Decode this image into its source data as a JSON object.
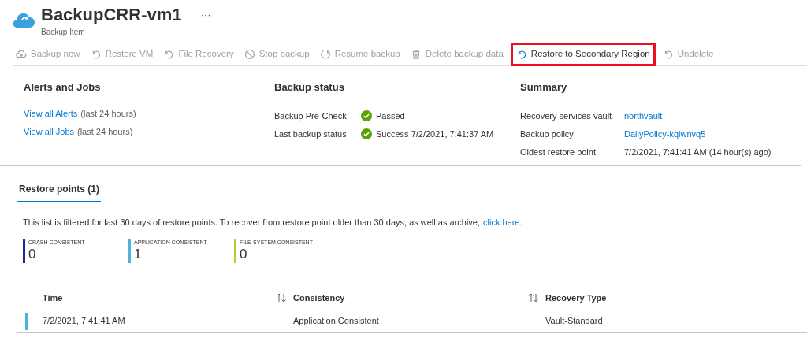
{
  "header": {
    "title": "BackupCRR-vm1",
    "subtitle": "Backup Item",
    "more": "···"
  },
  "toolbar": [
    {
      "label": "Backup now",
      "kind": "backup",
      "disabled": true,
      "highlighted": false
    },
    {
      "label": "Restore VM",
      "kind": "restore",
      "disabled": true,
      "highlighted": false
    },
    {
      "label": "File Recovery",
      "kind": "restore",
      "disabled": true,
      "highlighted": false
    },
    {
      "label": "Stop backup",
      "kind": "stop",
      "disabled": true,
      "highlighted": false
    },
    {
      "label": "Resume backup",
      "kind": "resume",
      "disabled": true,
      "highlighted": false
    },
    {
      "label": "Delete backup data",
      "kind": "delete",
      "disabled": true,
      "highlighted": false
    },
    {
      "label": "Restore to Secondary Region",
      "kind": "restore",
      "disabled": false,
      "highlighted": true
    },
    {
      "label": "Undelete",
      "kind": "restore",
      "disabled": true,
      "highlighted": false
    }
  ],
  "alerts_and_jobs": {
    "title": "Alerts and Jobs",
    "links": [
      {
        "link": "View all Alerts",
        "note": "(last 24 hours)"
      },
      {
        "link": "View all Jobs",
        "note": "(last 24 hours)"
      }
    ]
  },
  "backup_status": {
    "title": "Backup status",
    "rows": [
      {
        "label": "Backup Pre-Check",
        "value": "Passed"
      },
      {
        "label": "Last backup status",
        "value": "Success 7/2/2021, 7:41:37 AM"
      }
    ]
  },
  "summary": {
    "title": "Summary",
    "rows": [
      {
        "label": "Recovery services vault",
        "value": "northvault",
        "kind": "link"
      },
      {
        "label": "Backup policy",
        "value": "DailyPolicy-kqlwnvq5",
        "kind": "link"
      },
      {
        "label": "Oldest restore point",
        "value": "7/2/2021, 7:41:41 AM (14 hour(s) ago)",
        "kind": "text"
      }
    ]
  },
  "tabs": [
    {
      "label": "Restore points (1)",
      "selected": true
    }
  ],
  "notice": {
    "text": "This list is filtered for last 30 days of restore points. To recover from restore point older than 30 days, as well as archive,",
    "link": "click here."
  },
  "counters": [
    {
      "label": "CRASH CONSISTENT",
      "value": "0",
      "color": "#1b2a8a"
    },
    {
      "label": "APPLICATION CONSISTENT",
      "value": "1",
      "color": "#4fb3d9"
    },
    {
      "label": "FILE-SYSTEM CONSISTENT",
      "value": "0",
      "color": "#b5cc33"
    }
  ],
  "table": {
    "columns": [
      "Time",
      "Consistency",
      "Recovery Type"
    ],
    "rows": [
      {
        "color": "#4fb3d9",
        "cells": [
          "7/2/2021, 7:41:41 AM",
          "Application Consistent",
          "Vault-Standard"
        ]
      }
    ]
  }
}
